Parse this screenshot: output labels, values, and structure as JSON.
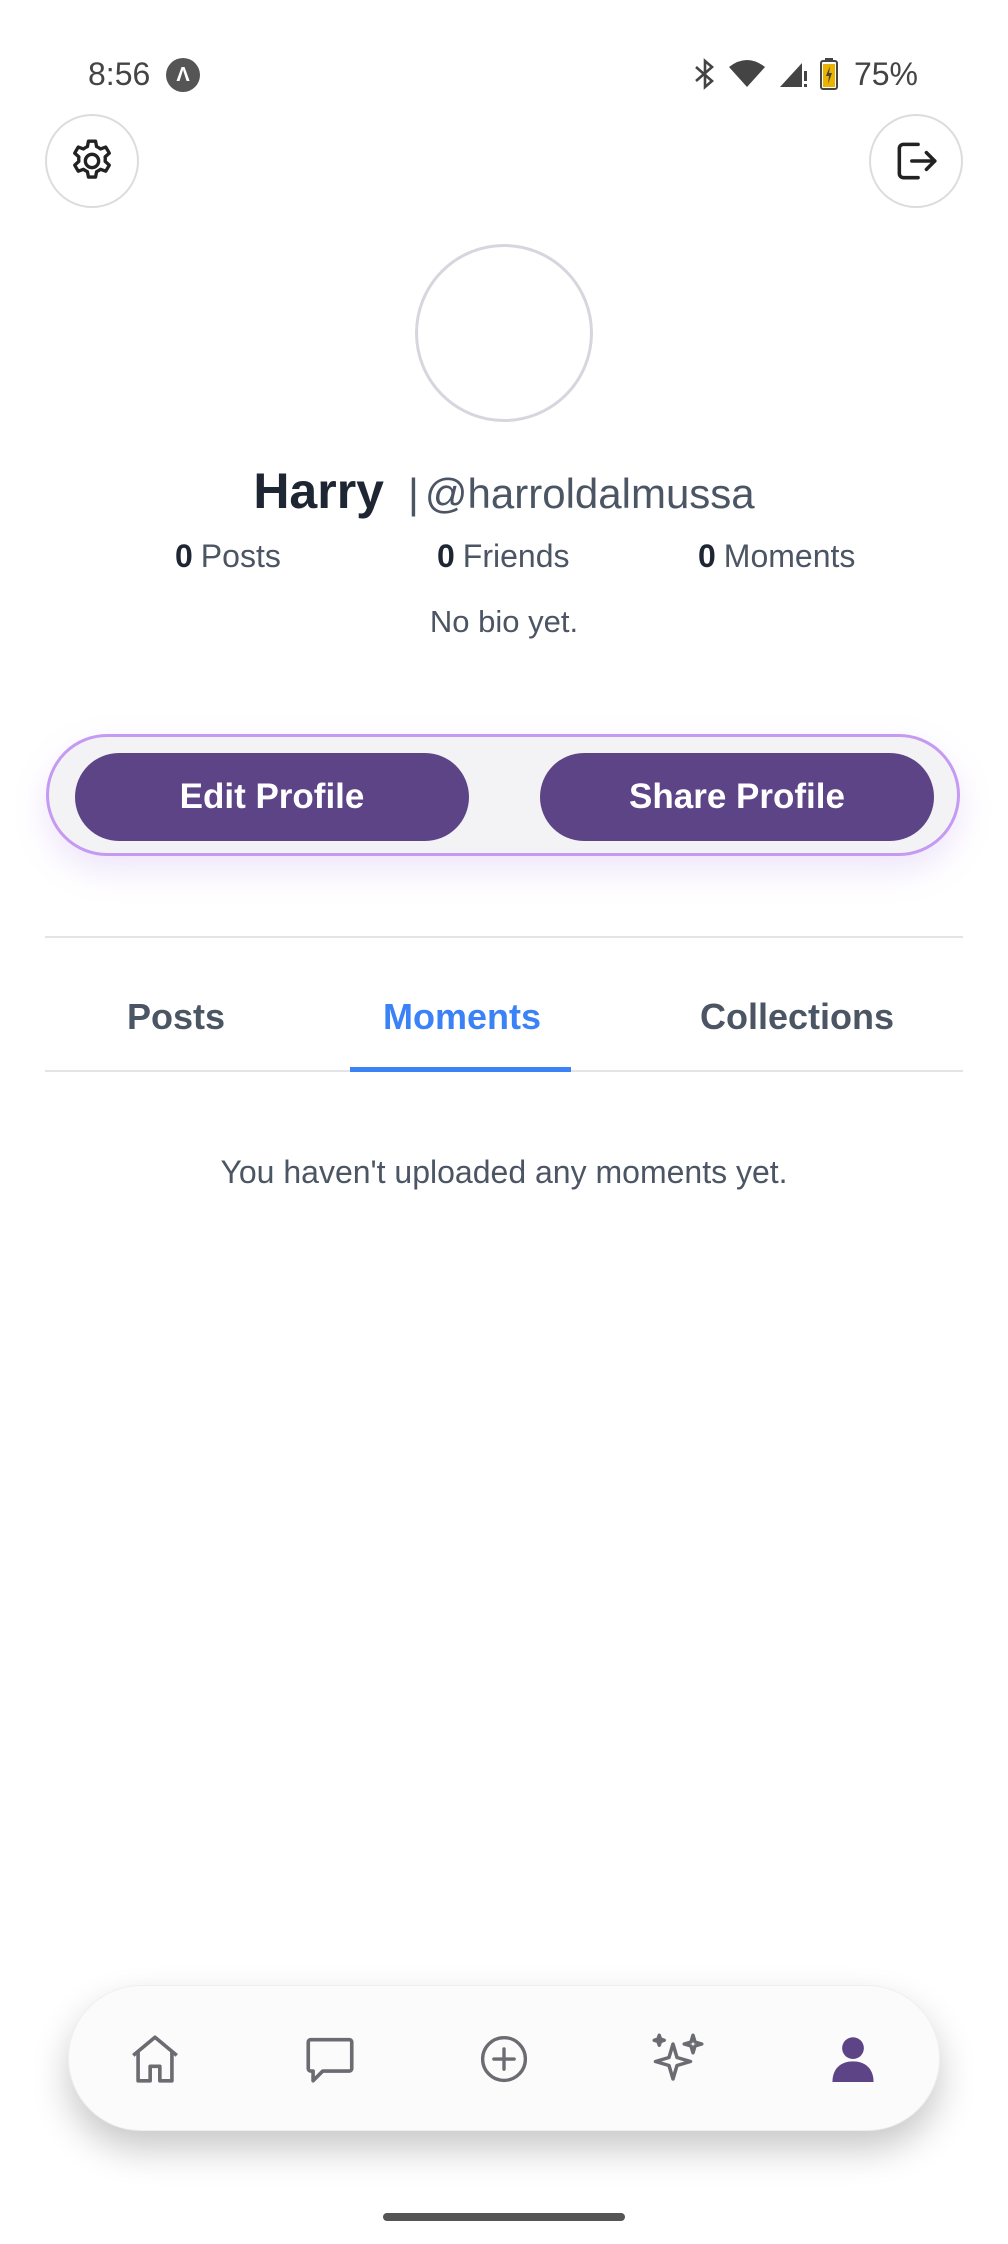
{
  "status_bar": {
    "time": "8:56",
    "app_indicator": "Λ",
    "battery": "75%",
    "icons": [
      "bluetooth-icon",
      "wifi-icon",
      "signal-icon",
      "battery-icon"
    ]
  },
  "header": {
    "settings_icon": "gear-icon",
    "logout_icon": "logout-icon"
  },
  "profile": {
    "name": "Harry",
    "username_separator": "|",
    "username": "@harroldalmussa",
    "bio": "No bio yet."
  },
  "stats": {
    "posts_count": "0",
    "posts_label": "Posts",
    "friends_count": "0",
    "friends_label": "Friends",
    "moments_count": "0",
    "moments_label": "Moments"
  },
  "actions": {
    "edit_label": "Edit Profile",
    "share_label": "Share Profile"
  },
  "tabs": [
    {
      "label": "Posts",
      "active": false
    },
    {
      "label": "Moments",
      "active": true
    },
    {
      "label": "Collections",
      "active": false
    }
  ],
  "content": {
    "empty_message": "You haven't uploaded any moments yet."
  },
  "bottom_nav": {
    "items": [
      {
        "icon": "home-icon",
        "active": false
      },
      {
        "icon": "chat-icon",
        "active": false
      },
      {
        "icon": "add-circle-icon",
        "active": false
      },
      {
        "icon": "sparkle-icon",
        "active": false
      },
      {
        "icon": "profile-icon",
        "active": true
      }
    ]
  },
  "colors": {
    "accent_purple": "#5c4487",
    "tab_active_blue": "#3b82f6",
    "action_border": "#c59af2"
  }
}
